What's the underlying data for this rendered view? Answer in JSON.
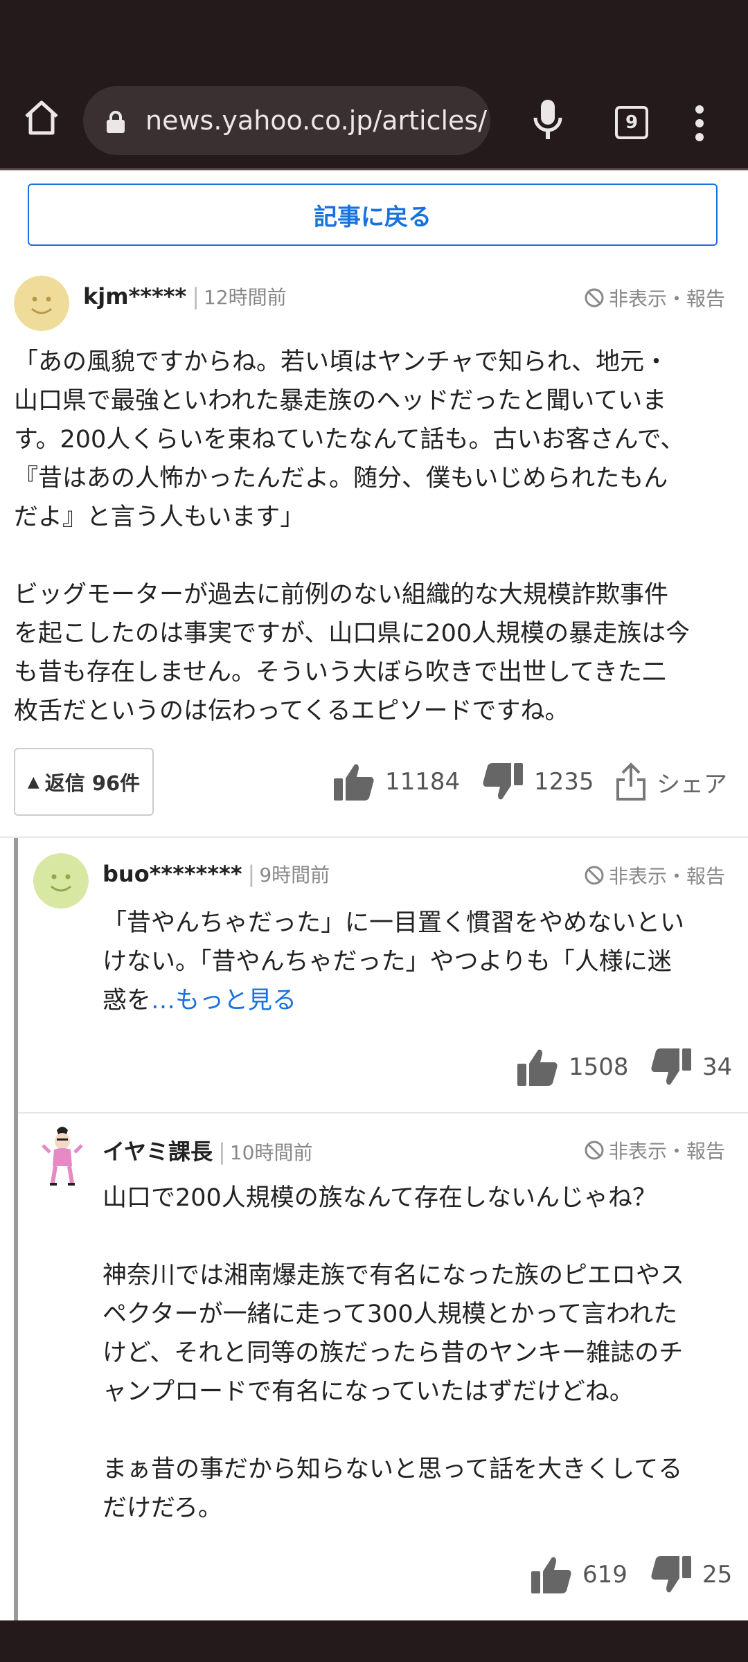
{
  "browser": {
    "url": "news.yahoo.co.jp/articles/",
    "tab_count": "9",
    "icons": [
      "home-icon",
      "lock-icon",
      "mic-icon",
      "tabs-icon",
      "more-vert-icon"
    ]
  },
  "back_button": {
    "label": "記事に戻る"
  },
  "comment": {
    "username": "kjm*****",
    "time": "12時間前",
    "hide_report": "非表示・報告",
    "text": "「あの風貌ですからね。若い頃はヤンチャで知られ、地元・\n山口県で最強といわれた暴走族のヘッドだったと聞いていま\nす。200人くらいを束ねていたなんて話も。古いお客さんで、\n『昔はあの人怖かったんだよ。随分、僕もいじめられたもん\nだよ』と言う人もいます」\n\nビッグモーターが過去に前例のない組織的な大規模詐欺事件\nを起こしたのは事実ですが、山口県に200人規模の暴走族は今\nも昔も存在しません。そういう大ぼら吹きで出世してきた二\n枚舌だというのは伝わってくるエピソードですね。",
    "reply_label": "返信 96件",
    "likes": "11184",
    "dislikes": "1235",
    "share_label": "シェア"
  },
  "replies": [
    {
      "username": "buo********",
      "time": "9時間前",
      "hide_report": "非表示・報告",
      "text": "「昔やんちゃだった」に一目置く慣習をやめないとい\nけない。「昔やんちゃだった」やつよりも「人様に迷\n惑を",
      "more": "…もっと見る",
      "likes": "1508",
      "dislikes": "34"
    },
    {
      "username": "イヤミ課長",
      "time": "10時間前",
      "hide_report": "非表示・報告",
      "text": "山口で200人規模の族なんて存在しないんじゃね？\n\n神奈川では湘南爆走族で有名になった族のピエロやス\nペクターが一緒に走って300人規模とかって言われた\nけど、それと同等の族だったら昔のヤンキー雑誌のチ\nャンプロードで有名になっていたはずだけどね。\n\nまぁ昔の事だから知らないと思って話を大きくしてる\nだけだろ。",
      "likes": "619",
      "dislikes": "25"
    }
  ],
  "colors": {
    "accent": "#1871e0",
    "chrome": "#241a1b"
  }
}
